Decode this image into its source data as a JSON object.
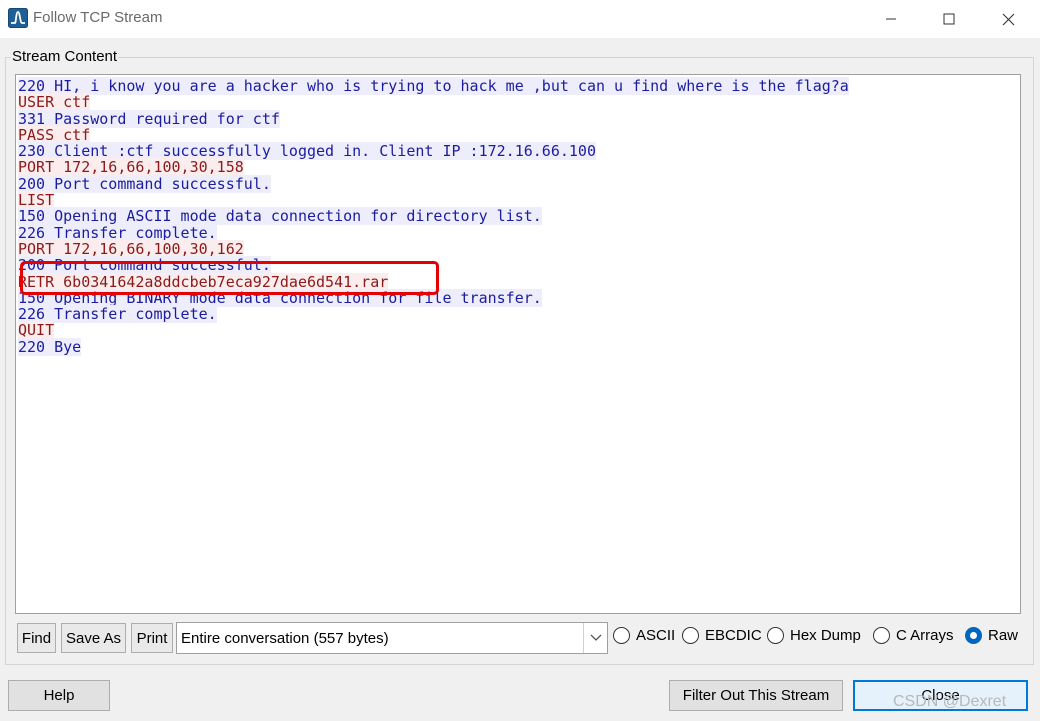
{
  "window": {
    "title": "Follow TCP Stream"
  },
  "group_label": "Stream Content",
  "stream_lines": [
    {
      "dir": "server",
      "text": "220 HI, i know you are a hacker who is trying to hack me ,but can u find where is the flag?a"
    },
    {
      "dir": "client",
      "text": "USER ctf"
    },
    {
      "dir": "server",
      "text": "331 Password required for ctf"
    },
    {
      "dir": "client",
      "text": "PASS ctf"
    },
    {
      "dir": "server",
      "text": "230 Client :ctf successfully logged in. Client IP :172.16.66.100"
    },
    {
      "dir": "client",
      "text": "PORT 172,16,66,100,30,158"
    },
    {
      "dir": "server",
      "text": "200 Port command successful."
    },
    {
      "dir": "client",
      "text": "LIST"
    },
    {
      "dir": "server",
      "text": "150 Opening ASCII mode data connection for directory list."
    },
    {
      "dir": "server",
      "text": "226 Transfer complete."
    },
    {
      "dir": "client",
      "text": "PORT 172,16,66,100,30,162"
    },
    {
      "dir": "server",
      "text": "200 Port command successful."
    },
    {
      "dir": "client",
      "text": "RETR 6b0341642a8ddcbeb7eca927dae6d541.rar"
    },
    {
      "dir": "server",
      "text": "150 Opening BINARY mode data connection for file transfer."
    },
    {
      "dir": "server",
      "text": "226 Transfer complete."
    },
    {
      "dir": "client",
      "text": "QUIT"
    },
    {
      "dir": "server",
      "text": "220 Bye"
    }
  ],
  "buttons": {
    "find": "Find",
    "save_as": "Save As",
    "print": "Print",
    "help": "Help",
    "filter_out": "Filter Out This Stream",
    "close": "Close"
  },
  "conversation_select": {
    "value": "Entire conversation (557 bytes)"
  },
  "format_options": [
    {
      "label": "ASCII",
      "checked": false
    },
    {
      "label": "EBCDIC",
      "checked": false
    },
    {
      "label": "Hex Dump",
      "checked": false
    },
    {
      "label": "C Arrays",
      "checked": false
    },
    {
      "label": "Raw",
      "checked": true
    }
  ],
  "watermark": "CSDN @Dexret",
  "colors": {
    "client_text": "#8b1a1a",
    "client_bg": "#fbeded",
    "server_text": "#1c1c9e",
    "server_bg": "#ededfb",
    "highlight_border": "#e60000",
    "radio_selected": "#0067c0"
  }
}
